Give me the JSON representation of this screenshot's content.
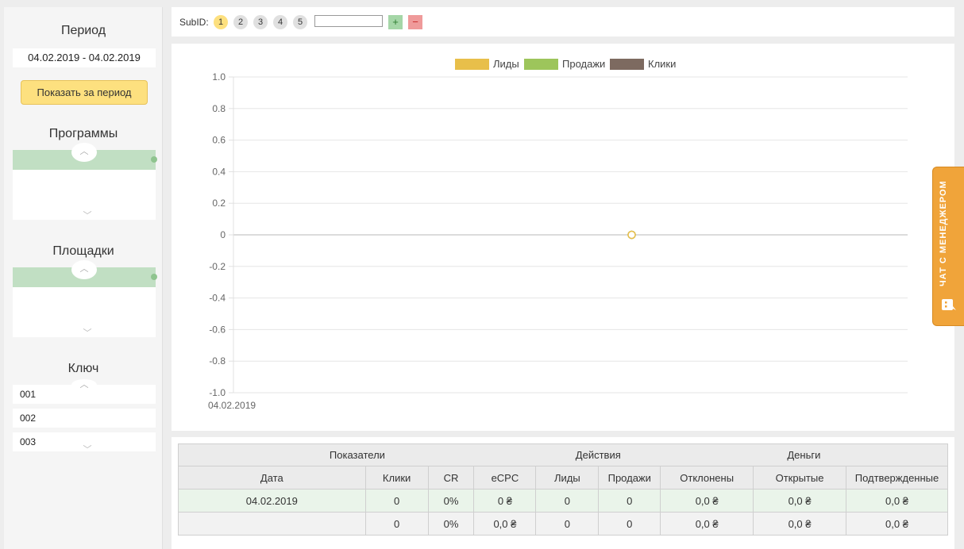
{
  "sidebar": {
    "period_title": "Период",
    "period_value": "04.02.2019 - 04.02.2019",
    "show_button": "Показать за период",
    "programs_title": "Программы",
    "sites_title": "Площадки",
    "key_title": "Ключ",
    "key_items": [
      "001",
      "002",
      "003"
    ]
  },
  "subid": {
    "label": "SubID:",
    "options": [
      "1",
      "2",
      "3",
      "4",
      "5"
    ],
    "active": "1",
    "input_value": "",
    "add_label": "+",
    "remove_label": "−"
  },
  "chart_data": {
    "type": "line",
    "legend_position": "top-center",
    "categories": [
      "04.02.2019"
    ],
    "series": [
      {
        "name": "Лиды",
        "color": "#e8bf4a",
        "values": [
          0
        ]
      },
      {
        "name": "Продажи",
        "color": "#9dc55b",
        "values": [
          0
        ]
      },
      {
        "name": "Клики",
        "color": "#7d6a60",
        "values": [
          0
        ]
      }
    ],
    "ylim": [
      -1.0,
      1.0
    ],
    "yticks": [
      "1.0",
      "0.8",
      "0.6",
      "0.4",
      "0.2",
      "0",
      "-0.2",
      "-0.4",
      "-0.6",
      "-0.8",
      "-1.0"
    ],
    "grid": true
  },
  "table": {
    "group_headers": [
      "Показатели",
      "Действия",
      "Деньги"
    ],
    "columns": [
      "Дата",
      "Клики",
      "CR",
      "eCPC",
      "Лиды",
      "Продажи",
      "Отклонены",
      "Открытые",
      "Подтвержденные"
    ],
    "rows": [
      [
        "04.02.2019",
        "0",
        "0%",
        "0 ₴",
        "0",
        "0",
        "0,0 ₴",
        "0,0 ₴",
        "0,0 ₴"
      ],
      [
        "",
        "0",
        "0%",
        "0,0 ₴",
        "0",
        "0",
        "0,0 ₴",
        "0,0 ₴",
        "0,0 ₴"
      ]
    ]
  },
  "chat": {
    "label": "ЧАТ С МЕНЕДЖЕРОМ",
    "color": "#f0a43a"
  }
}
